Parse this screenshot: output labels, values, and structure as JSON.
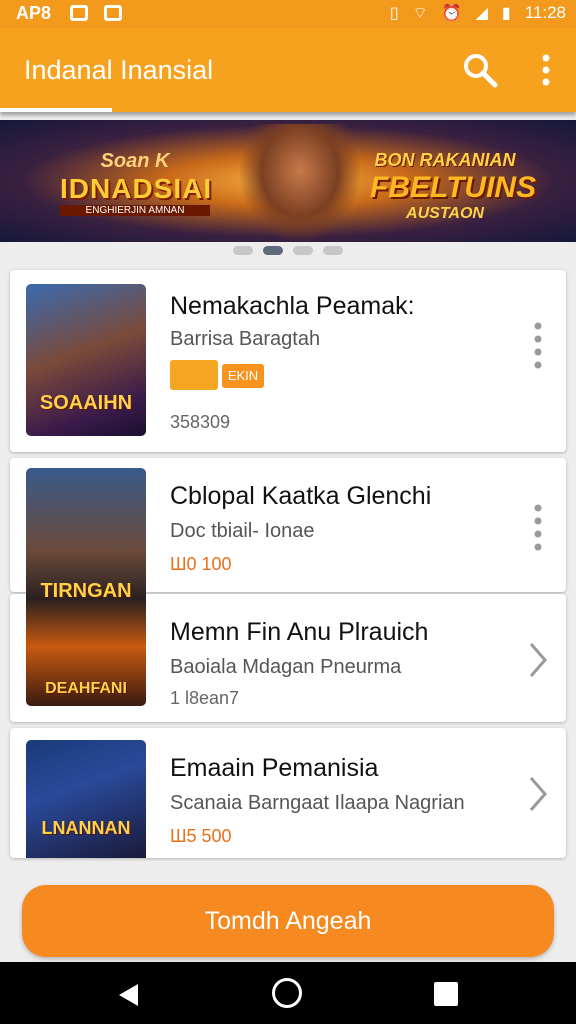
{
  "status_bar": {
    "left_text": "AP8",
    "time": "11:28"
  },
  "app_bar": {
    "title": "Indanal Inansial",
    "search_icon": "search-icon",
    "more_icon": "more-vert-icon"
  },
  "banner": {
    "left_top": "Soan K",
    "left_main": "IDNADSIAI",
    "left_sub": "ENGHIERJIN AMNAN",
    "right_top": "BON RAKANIAN",
    "right_main": "FBELTUINS",
    "right_sub": "AUSTAON",
    "pages": 4,
    "active_page": 2
  },
  "games": [
    {
      "title": "Nemakachla Peamak:",
      "subtitle": "Barrisa Baragtah",
      "badge": "EKIN",
      "meta": "358309",
      "thumb_label": "SOAAIHN",
      "action": "kebab"
    },
    {
      "title": "Cblopal Kaatka Glenchi",
      "subtitle": "Doc tbiail- Ionae",
      "price": "Ш0 100",
      "thumb_label": "TIRNGAN",
      "thumb_label2": "DEAHFANI",
      "action": "kebab"
    },
    {
      "title": "Memn Fin Anu Plrauich",
      "subtitle": "Baoiala Mdagan Pneurma",
      "meta": "1 l8ean7",
      "action": "chevron"
    },
    {
      "title": "Emaain Pemanisia",
      "subtitle": "Scanaia Barngaat Ilaapa Nagrian",
      "price": "Ш5 500",
      "thumb_label": "LNANNAN",
      "action": "chevron"
    }
  ],
  "cta_label": "Tomdh Angeah",
  "colors": {
    "accent": "#f7a21f",
    "button": "#f6891f",
    "price": "#e8711a"
  }
}
